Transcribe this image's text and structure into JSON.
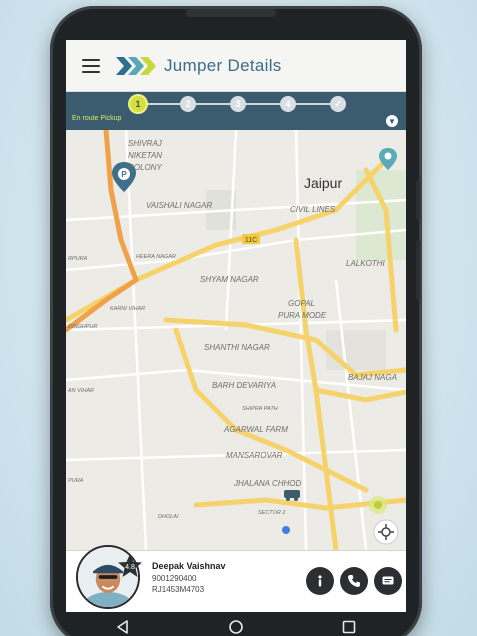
{
  "app": {
    "title": "Jumper Details",
    "accent": "#3c6d86",
    "stepper_color": "#3b5b6e",
    "highlight": "#d7df3a"
  },
  "stepper": {
    "status": "En route Pickup",
    "steps": [
      "1",
      "2",
      "3",
      "4",
      "✓"
    ],
    "active_index": 0
  },
  "map": {
    "city": "Jaipur",
    "road_badge": "11C",
    "labels": [
      {
        "text": "SHIVRAJ",
        "cls": "s"
      },
      {
        "text": "NIKETAN",
        "cls": "s"
      },
      {
        "text": "COLONY",
        "cls": "s"
      },
      {
        "text": "VAISHALI NAGAR",
        "cls": "m"
      },
      {
        "text": "CIVIL LINES",
        "cls": "m"
      },
      {
        "text": "HEERA NAGAR",
        "cls": "xs"
      },
      {
        "text": "RPURA",
        "cls": "xs"
      },
      {
        "text": "LALKOTHI",
        "cls": "m"
      },
      {
        "text": "SHYAM NAGAR",
        "cls": "m"
      },
      {
        "text": "GOPAL",
        "cls": "m"
      },
      {
        "text": "PURA MODE",
        "cls": "m"
      },
      {
        "text": "KARNI VIHAR",
        "cls": "xs"
      },
      {
        "text": "DINGHPUR",
        "cls": "xs"
      },
      {
        "text": "SHANTHI NAGAR",
        "cls": "m"
      },
      {
        "text": "BAJAJ NAGA",
        "cls": "m"
      },
      {
        "text": "AN VIHAR",
        "cls": "xs"
      },
      {
        "text": "BARH DEVARIYA",
        "cls": "m"
      },
      {
        "text": "SHIPRA PATH",
        "cls": "xs"
      },
      {
        "text": "AGARWAL FARM",
        "cls": "m"
      },
      {
        "text": "MANSAROVAR",
        "cls": "m"
      },
      {
        "text": "JHALANA CHHOD",
        "cls": "m"
      },
      {
        "text": "PURA",
        "cls": "xs"
      },
      {
        "text": "SECTOR 2",
        "cls": "xs"
      },
      {
        "text": "DHOLAI",
        "cls": "xs"
      }
    ]
  },
  "driver": {
    "name": "Deepak Vaishnav",
    "phone": "9001290400",
    "plate": "RJ1453M4703",
    "rating": "4.8"
  },
  "actions": [
    {
      "name": "info-button",
      "icon": "info-icon"
    },
    {
      "name": "call-button",
      "icon": "phone-icon"
    },
    {
      "name": "message-button",
      "icon": "message-icon"
    }
  ],
  "android_nav": [
    "back-icon",
    "home-icon",
    "recents-icon"
  ]
}
